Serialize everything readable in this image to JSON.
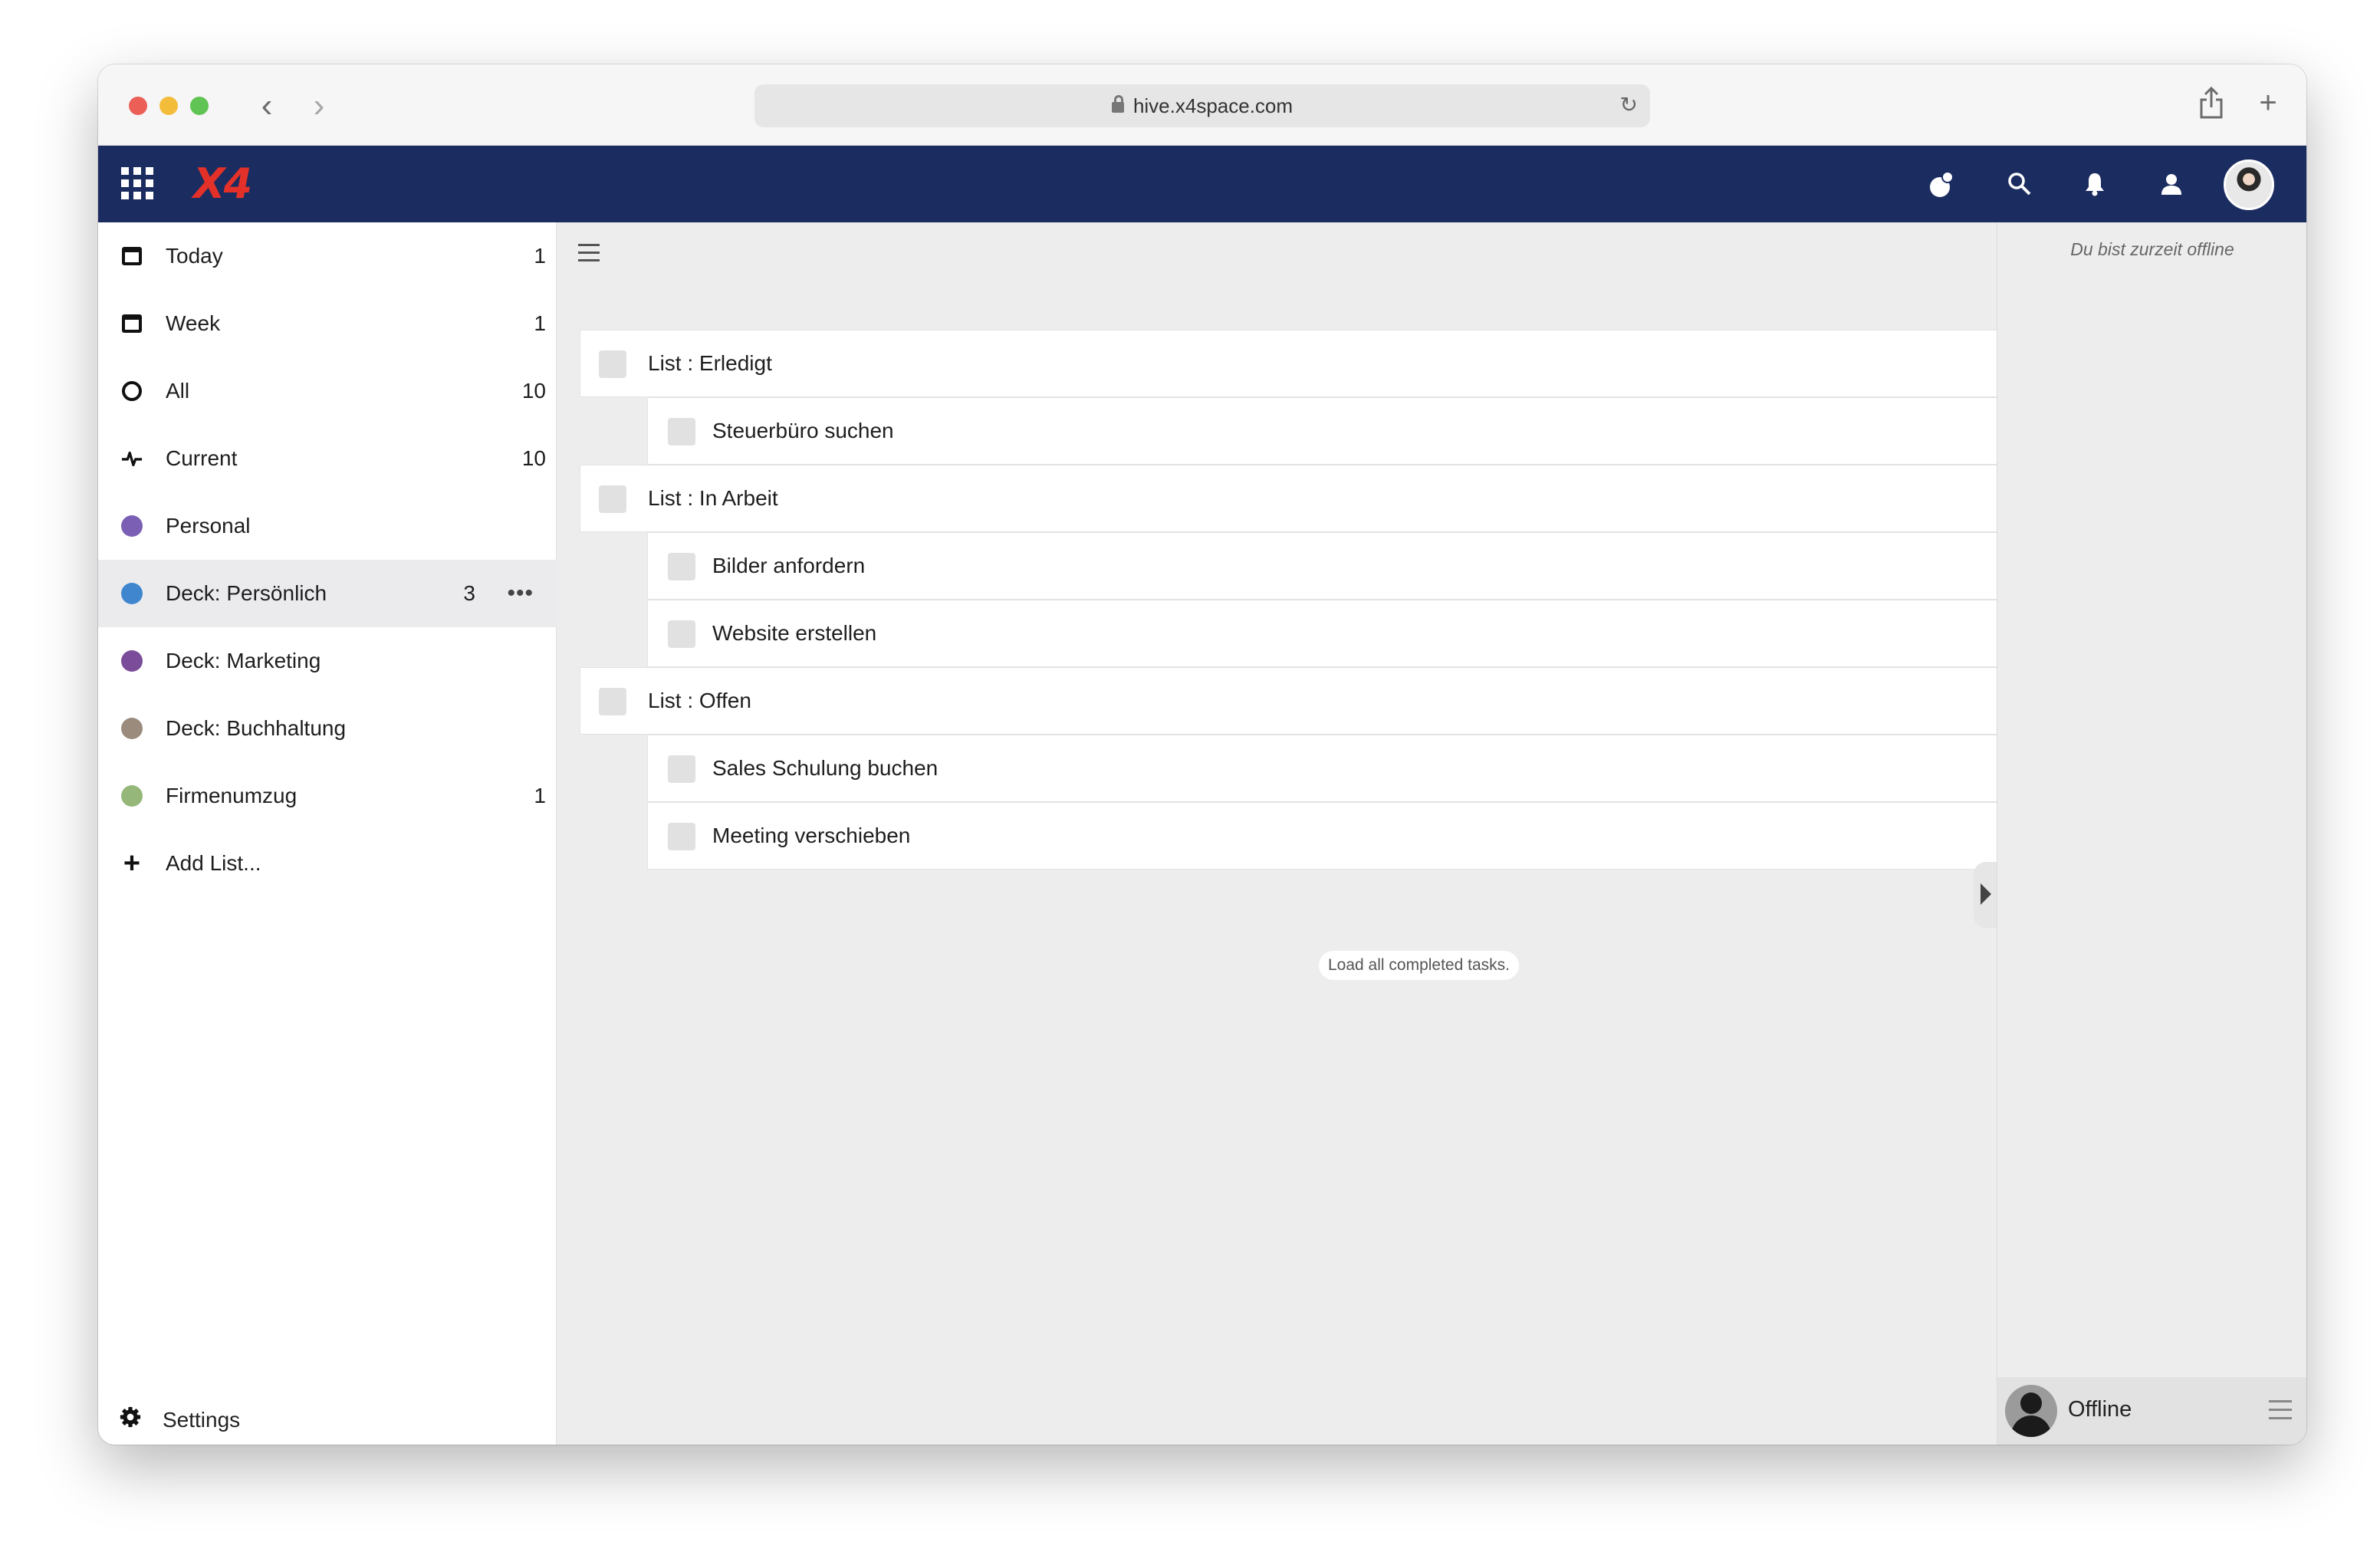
{
  "browser": {
    "url": "hive.x4space.com"
  },
  "app": {
    "logo_text": "X4",
    "brand_color": "#1b2c60",
    "logo_color": "#e3312a",
    "header_icons": [
      "contacts-icon",
      "search-icon",
      "bell-icon",
      "user-icon"
    ]
  },
  "sidebar": {
    "items": [
      {
        "label": "Today",
        "count": "1",
        "icon": "calendar-icon"
      },
      {
        "label": "Week",
        "count": "1",
        "icon": "calendar-icon"
      },
      {
        "label": "All",
        "count": "10",
        "icon": "circle-icon"
      },
      {
        "label": "Current",
        "count": "10",
        "icon": "pulse-icon"
      },
      {
        "label": "Personal",
        "count": "",
        "icon": "dot",
        "color": "#7b5fb5"
      },
      {
        "label": "Deck: Persönlich",
        "count": "3",
        "icon": "dot",
        "color": "#3f86cf",
        "active": true
      },
      {
        "label": "Deck: Marketing",
        "count": "",
        "icon": "dot",
        "color": "#7b4c9a"
      },
      {
        "label": "Deck: Buchhaltung",
        "count": "",
        "icon": "dot",
        "color": "#9a8b7d"
      },
      {
        "label": "Firmenumzug",
        "count": "1",
        "icon": "dot",
        "color": "#95b77a"
      },
      {
        "label": "Add List...",
        "count": "",
        "icon": "plus-icon"
      }
    ],
    "settings_label": "Settings"
  },
  "tasks": {
    "groups": [
      {
        "title": "List : Erledigt",
        "items": [
          "Steuerbüro suchen"
        ]
      },
      {
        "title": "List : In Arbeit",
        "items": [
          "Bilder anfordern",
          "Website erstellen"
        ]
      },
      {
        "title": "List : Offen",
        "items": [
          "Sales Schulung buchen",
          "Meeting verschieben"
        ]
      }
    ],
    "load_completed_label": "Load all completed tasks."
  },
  "right_panel": {
    "offline_note": "Du bist zurzeit offline",
    "user_status": "Offline"
  }
}
